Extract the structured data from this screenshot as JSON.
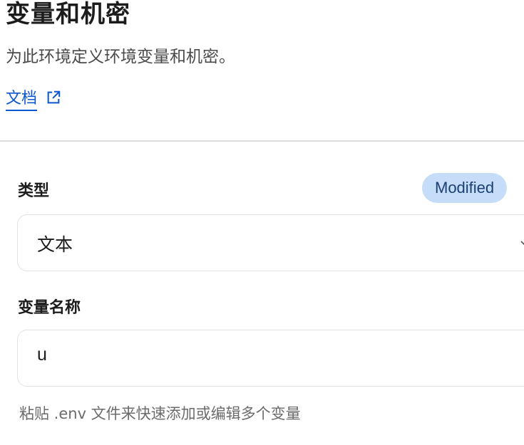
{
  "header": {
    "title": "变量和机密",
    "description": "为此环境定义环境变量和机密。",
    "docs_link": "文档"
  },
  "form": {
    "type_label": "类型",
    "status_badge": "Modified",
    "type_value": "文本",
    "var_name_label": "变量名称",
    "var_name_value": "u",
    "helper_text": "粘贴 .env 文件来快速添加或编辑多个变量"
  },
  "colors": {
    "link": "#0b57d0",
    "badge_bg": "#c6ddf9",
    "badge_text": "#1c3f73"
  },
  "icons": {
    "docs_link": "external-link-icon",
    "select": "chevron-down-icon"
  }
}
